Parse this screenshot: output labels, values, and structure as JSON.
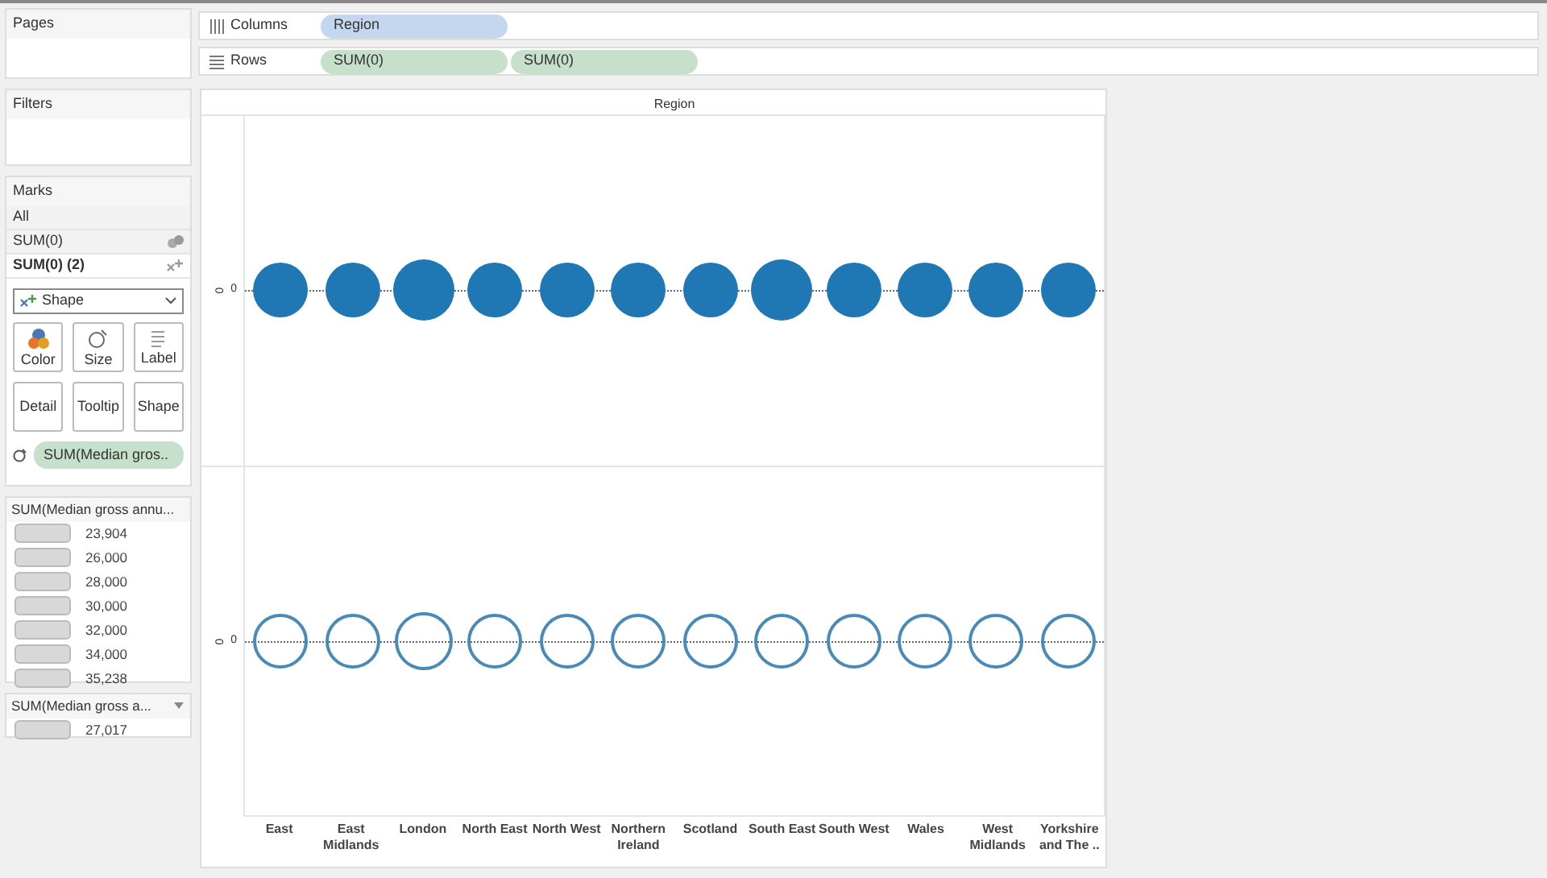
{
  "pages": {
    "title": "Pages"
  },
  "columns_shelf": {
    "label": "Columns",
    "pills": [
      "Region"
    ]
  },
  "rows_shelf": {
    "label": "Rows",
    "pills": [
      "SUM(0)",
      "SUM(0)"
    ]
  },
  "filters": {
    "title": "Filters"
  },
  "marks": {
    "title": "Marks",
    "layers": [
      {
        "label": "All",
        "selected": false
      },
      {
        "label": "SUM(0)",
        "selected": false
      },
      {
        "label": "SUM(0) (2)",
        "selected": true
      }
    ],
    "mark_type": "Shape",
    "buttons": [
      "Color",
      "Size",
      "Label",
      "Detail",
      "Tooltip",
      "Shape"
    ],
    "size_pill": "SUM(Median gros.."
  },
  "size_legend": {
    "title": "SUM(Median gross annu...",
    "items": [
      {
        "label": "23,904"
      },
      {
        "label": "26,000"
      },
      {
        "label": "28,000"
      },
      {
        "label": "30,000"
      },
      {
        "label": "32,000"
      },
      {
        "label": "34,000"
      },
      {
        "label": "35,238"
      }
    ]
  },
  "legend_2": {
    "title": "SUM(Median gross a...",
    "items": [
      {
        "label": "27,017"
      }
    ]
  },
  "chart": {
    "header": "Region",
    "axis_values": [
      "0",
      "0"
    ],
    "axis_ticks": [
      "0",
      "0"
    ],
    "regions": [
      {
        "label": "East",
        "large": false
      },
      {
        "label": "East Midlands",
        "large": false
      },
      {
        "label": "London",
        "large": true
      },
      {
        "label": "North East",
        "large": false
      },
      {
        "label": "North West",
        "large": false
      },
      {
        "label": "Northern Ireland",
        "large": false
      },
      {
        "label": "Scotland",
        "large": false
      },
      {
        "label": "South East",
        "large": true
      },
      {
        "label": "South West",
        "large": false
      },
      {
        "label": "Wales",
        "large": false
      },
      {
        "label": "West Midlands",
        "large": false
      },
      {
        "label": "Yorkshire and The ..",
        "large": false
      }
    ]
  }
}
